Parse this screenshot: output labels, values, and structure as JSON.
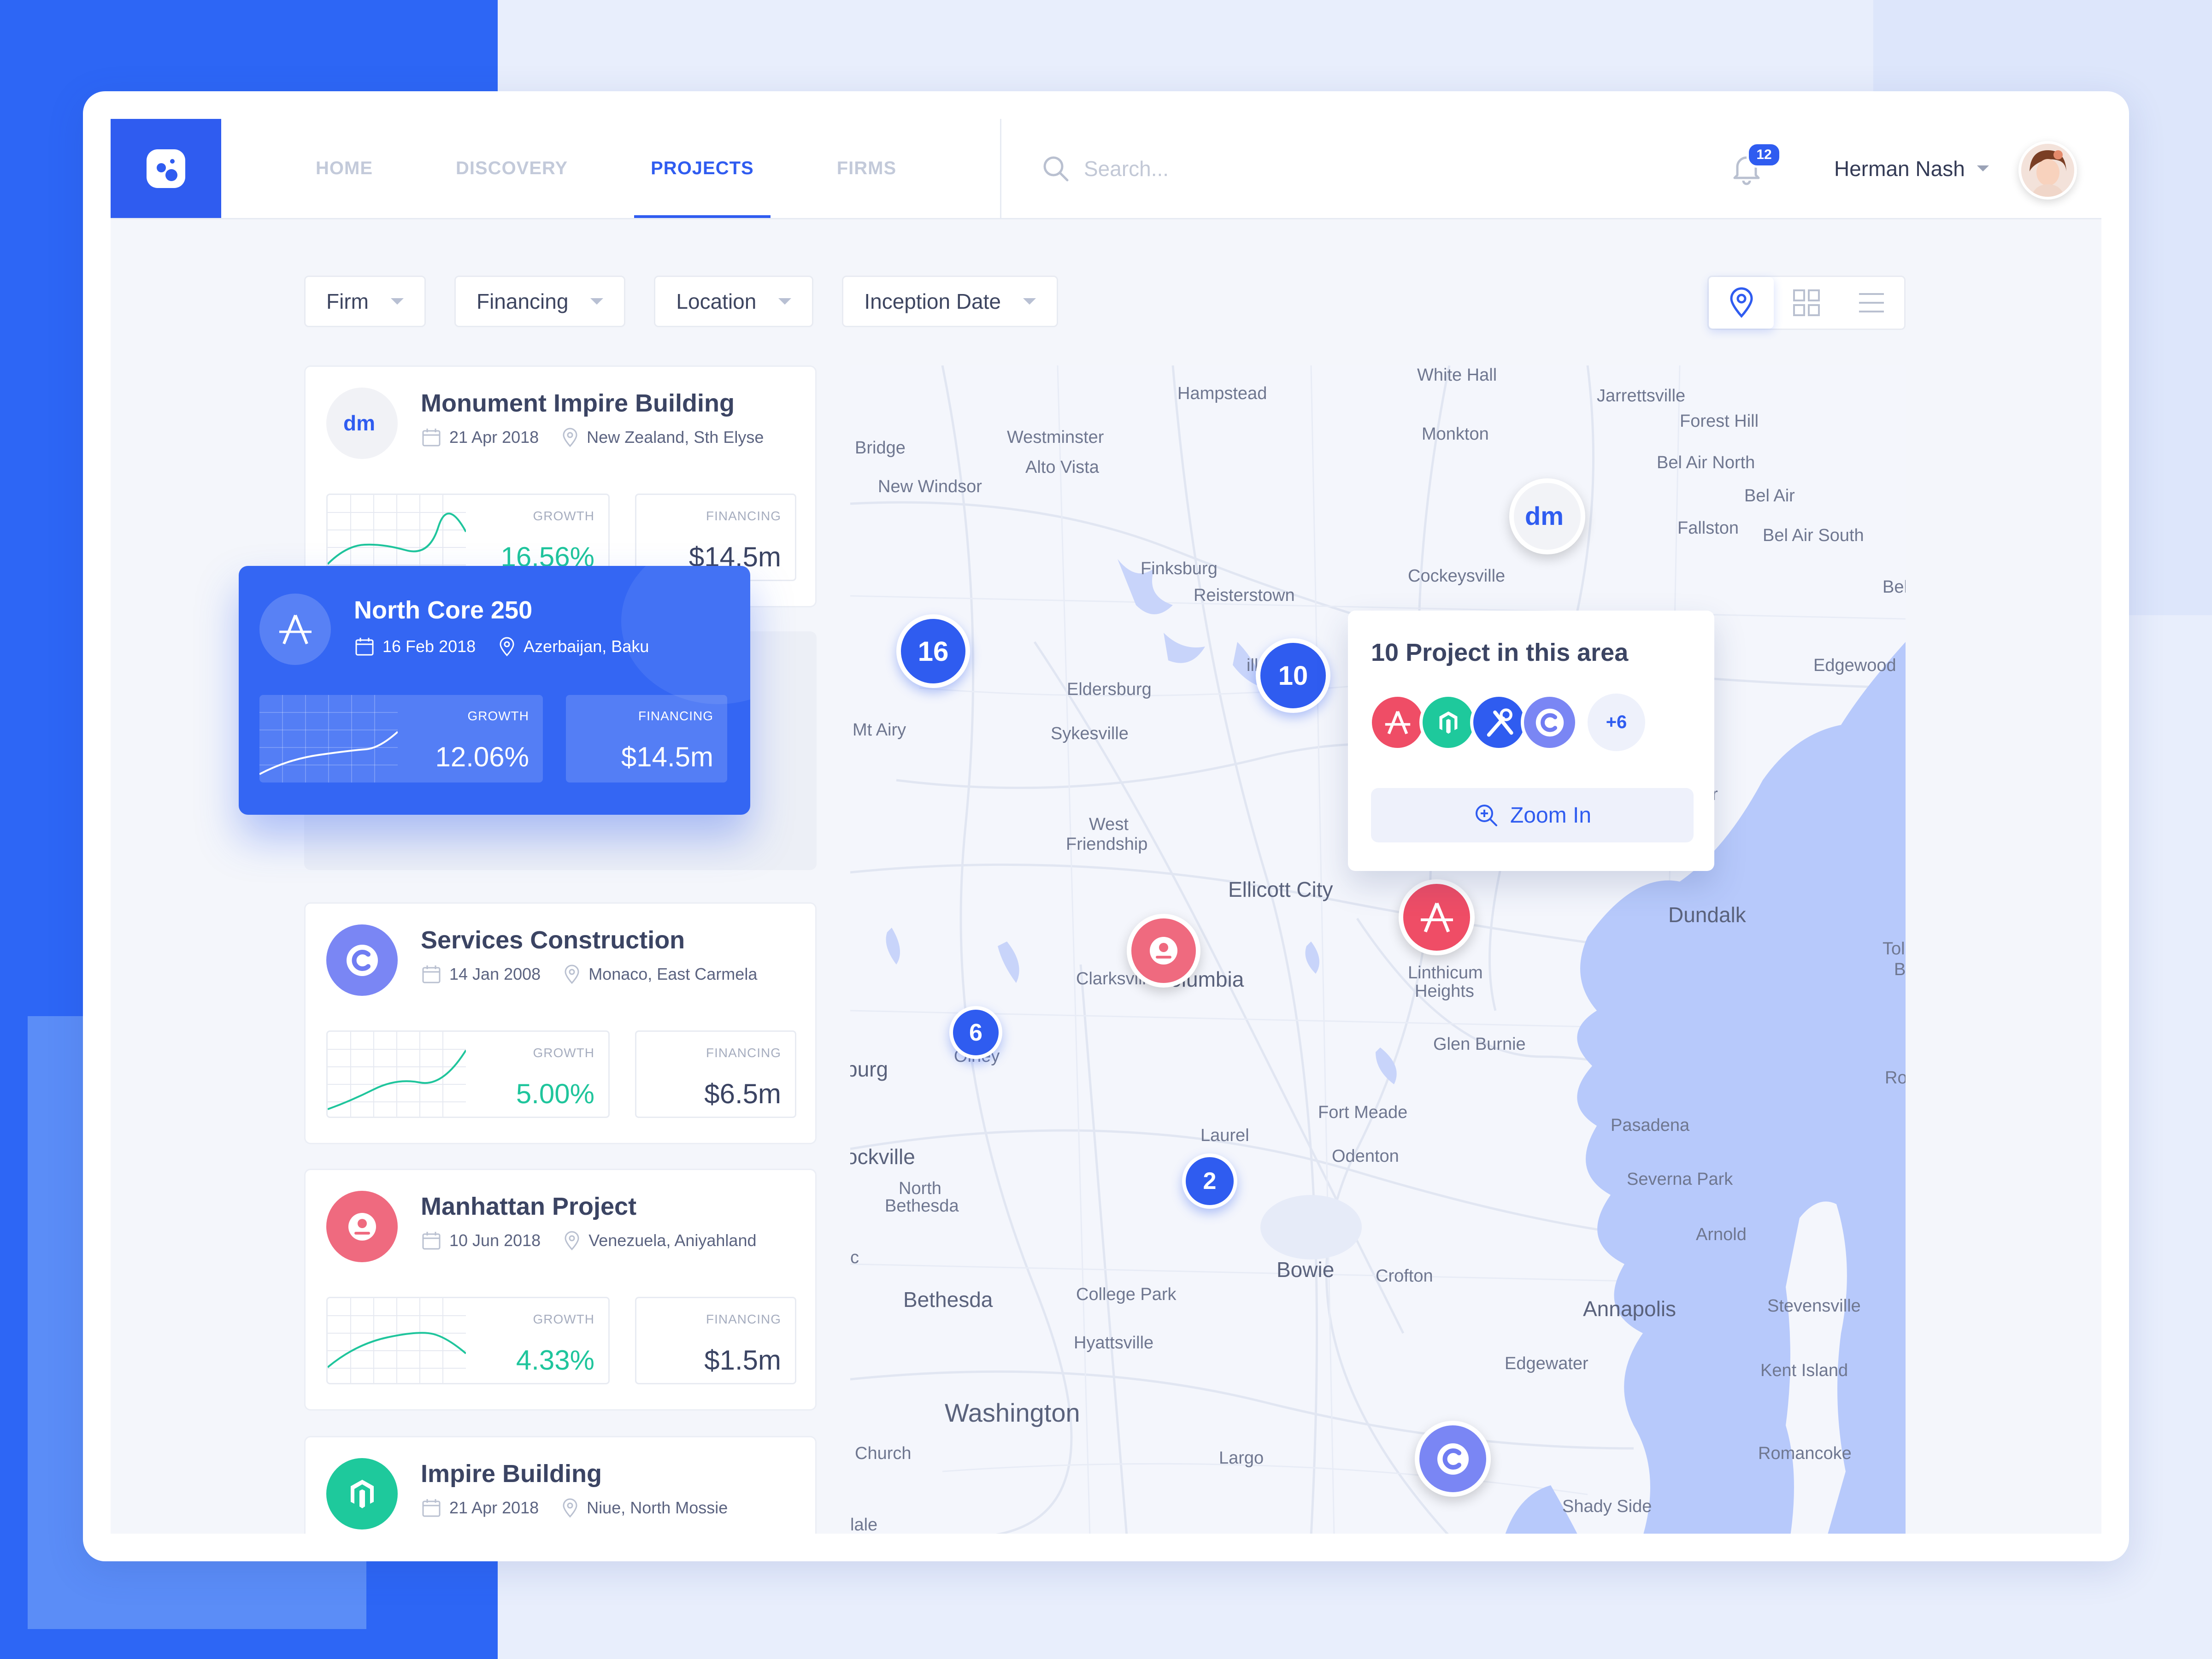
{
  "nav": {
    "home": "HOME",
    "discovery": "DISCOVERY",
    "projects": "PROJECTS",
    "firms": "FIRMS"
  },
  "search": {
    "placeholder": "Search..."
  },
  "notifications": {
    "count": "12"
  },
  "user": {
    "name": "Herman Nash"
  },
  "filters": {
    "firm": "Firm",
    "financing": "Financing",
    "location": "Location",
    "inception": "Inception Date"
  },
  "colors": {
    "accent": "#2f5cf0",
    "growth": "#1fc59c",
    "red": "#ef5a73",
    "green": "#1ec99c",
    "violet": "#6f7cf2"
  },
  "projects": [
    {
      "title": "Monument Impire Building",
      "date": "21 Apr 2018",
      "location": "New Zealand, Sth Elyse",
      "growth_label": "GROWTH",
      "growth": "16.56%",
      "financing_label": "FINANCING",
      "financing": "$14.5m",
      "icon": "dm-logo-icon"
    },
    {
      "title": "North Core 250",
      "date": "16 Feb 2018",
      "location": "Azerbaijan, Baku",
      "growth_label": "GROWTH",
      "growth": "12.06%",
      "financing_label": "FINANCING",
      "financing": "$14.5m",
      "icon": "a-logo-icon"
    },
    {
      "title": "Services Construction",
      "date": "14 Jan 2008",
      "location": "Monaco, East Carmela",
      "growth_label": "GROWTH",
      "growth": "5.00%",
      "financing_label": "FINANCING",
      "financing": "$6.5m",
      "icon": "c-logo-icon"
    },
    {
      "title": "Manhattan Project",
      "date": "10 Jun 2018",
      "location": "Venezuela, Aniyahland",
      "growth_label": "GROWTH",
      "growth": "4.33%",
      "financing_label": "FINANCING",
      "financing": "$1.5m",
      "icon": "person-logo-icon"
    },
    {
      "title": "Impire Building",
      "date": "21 Apr 2018",
      "location": "Niue, North Mossie",
      "icon": "m-logo-icon"
    }
  ],
  "map": {
    "places": [
      "Hampstead",
      "White Hall",
      "Jarrettsville",
      "Westminster",
      "Monkton",
      "Forest Hill",
      "Bridge",
      "Alto Vista",
      "Bel Air North",
      "New Windsor",
      "Bel Air",
      "Fallston",
      "Bel Air South",
      "Finksburg",
      "Reisterstown",
      "Cockeysville",
      "Bel",
      "Edgewood",
      "Eldersburg",
      "Mt Airy",
      "Sykesville",
      "ver",
      "West",
      "Friendship",
      "Ellicott City",
      "Dundalk",
      "Clarksville",
      "Columbia",
      "Linthicum",
      "Heights",
      "Tol",
      "B",
      "Olney",
      "burg",
      "Glen Burnie",
      "Ro",
      "Fort Meade",
      "Pasadena",
      "Laurel",
      "ockville",
      "Odenton",
      "Severna Park",
      "North",
      "Bethesda",
      "c",
      "Arnold",
      "Bowie",
      "Crofton",
      "Bethesda",
      "College Park",
      "Annapolis",
      "Stevensville",
      "Hyattsville",
      "Edgewater",
      "Kent Island",
      "Washington",
      "Church",
      "Largo",
      "Romancoke",
      "Shady Side",
      "lale",
      "ill"
    ],
    "clusters": [
      "16",
      "10",
      "6",
      "2"
    ],
    "popup": {
      "title": "10 Project in this area",
      "more": "+6",
      "zoom": "Zoom In"
    }
  }
}
